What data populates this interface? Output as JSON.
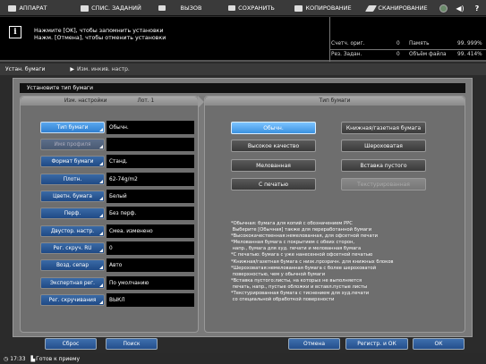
{
  "topbar": {
    "items": [
      {
        "label": "АППАРАТ",
        "icon": "machine-icon"
      },
      {
        "label": "СПИС. ЗАДАНИЙ",
        "icon": "job-list-icon"
      },
      {
        "label": "ВЫЗОВ",
        "icon": "recall-icon"
      },
      {
        "label": "СОХРАНИТЬ",
        "icon": "save-icon"
      },
      {
        "label": "КОПИРОВАНИЕ",
        "icon": "copy-icon"
      },
      {
        "label": "СКАНИРОВАНИЕ",
        "icon": "scan-icon"
      }
    ],
    "help_label": "?"
  },
  "info": {
    "line1": "Нажмите [OK], чтобы запомнить установки",
    "line2": "Нажм. [Отмена], чтобы отменить установки",
    "counter_label": "Счетч. ориг.",
    "counter_value": "0",
    "memory_label": "Память",
    "memory_value": "99. 999%",
    "volume_label": "Рез. Задан.",
    "volume_value": "0",
    "file_label": "Объём файла",
    "file_value": "99. 414%"
  },
  "breadcrumb": {
    "first": "Устан. бумаги",
    "second": "Изм. инкив. настр."
  },
  "panel_title": "Установите тип бумаги",
  "left": {
    "header_left": "Изм. настройки",
    "header_right": "Лот. 1",
    "rows": [
      {
        "button": "Тип бумаги",
        "value": "Обычн."
      },
      {
        "button": "Имя профиля",
        "value": ""
      },
      {
        "button": "Формат бумаги",
        "value": "Станд."
      },
      {
        "button": "Плотн.",
        "value": "62-74g/m2"
      },
      {
        "button": "Цветн. бумага",
        "value": "Белый"
      },
      {
        "button": "Перф.",
        "value": "Без перф."
      },
      {
        "button": "Двустор. настр.",
        "value": "Смеа. изменено"
      },
      {
        "button": "Рег. скруч. RU",
        "value": "0"
      },
      {
        "button": "Возд. сепар",
        "value": "Авто"
      },
      {
        "button": "Экспертная рег.",
        "value": "По умолчанию"
      },
      {
        "button": "Рег. скручивания",
        "value": "ВЫКЛ"
      }
    ]
  },
  "right": {
    "header": "Тип бумаги",
    "buttons": [
      "Обычн.",
      "Книжная/газетная бумага",
      "Высокое качество",
      "Шероховатая",
      "Мелованная",
      "Вставка пустого",
      "С печатью",
      "Текстурированная"
    ],
    "description": "*Обычная: бумага для копий с обозначением PPC\n Выберите [Обычная] также для переработанной бумаги\n*Высококачественная:немелованная, для офсетной печати\n*Мелованная бумага с покрытием с обеих сторон,\n напр., бумага для худ. печати и мелованная бумага\n*С печатью: бумага с уже нанесенной офсетной печатью\n*Книжная/газетная бумага с низк.прозрачн. для книжных блоков\n*Шероховатая:немелованная бумага с более шероховатой\n поверхностью, чем у обычной бумаги\n*Вставка пустого:листы, на которых не выполняется\n печать, напр., пустые обложки и вставл.пустые листы\n*Текстурированная бумага с тиснением для худ.печати\n со специальной обработкой поверхности"
  },
  "bottom": {
    "reset": "Сброс",
    "search": "Поиск",
    "cancel": "Отмена",
    "register_ok": "Регистр. и ОК",
    "ok": "ОК"
  },
  "status": {
    "time": "17:33",
    "ready": "Готов к приему"
  }
}
